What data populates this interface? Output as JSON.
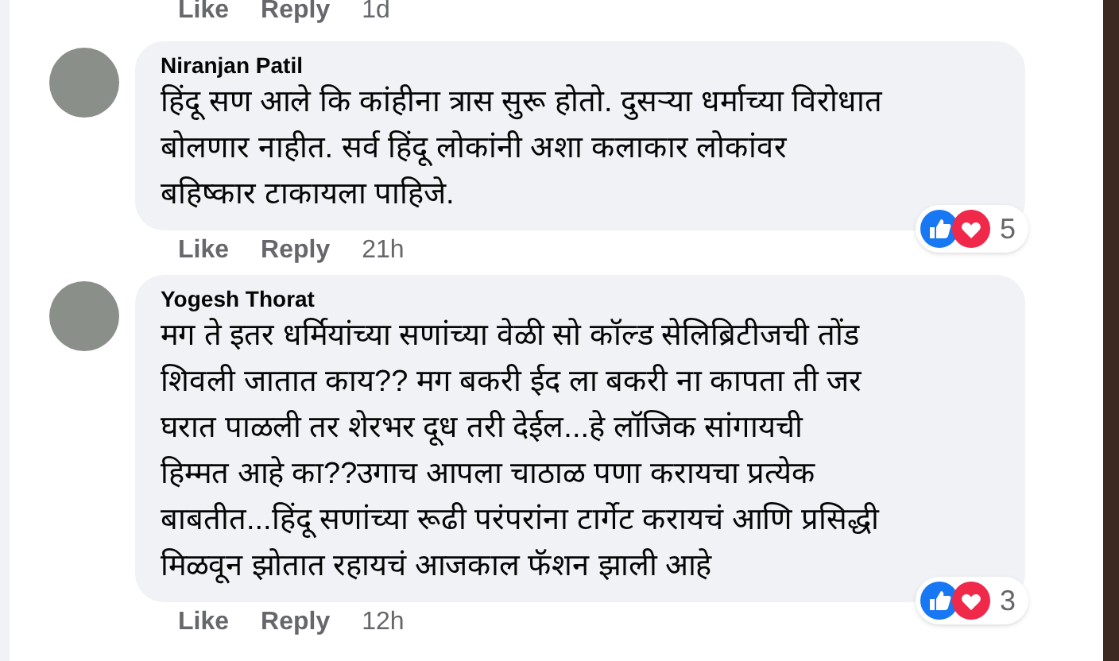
{
  "top_actions": {
    "like": "Like",
    "reply": "Reply",
    "time": "1d"
  },
  "comments": [
    {
      "author": "Niranjan Patil",
      "text": "हिंदू सण आले कि कांहीना त्रास सुरू होतो. दुसऱ्या धर्माच्या विरोधात\nबोलणार नाहीत. सर्व हिंदू लोकांनी अशा कलाकार लोकांवर\nबहिष्कार टाकायला पाहिजे.",
      "reaction_count": "5",
      "like": "Like",
      "reply": "Reply",
      "time": "21h"
    },
    {
      "author": "Yogesh Thorat",
      "text": "मग ते इतर धर्मियांच्या सणांच्या वेळी सो कॉल्ड सेलिब्रिटीजची तोंड\nशिवली जातात काय?? मग बकरी ईद ला बकरी ना कापता ती जर\nघरात पाळली तर शेरभर दूध तरी देईल...हे लॉजिक सांगायची\nहिम्मत आहे का??उगाच आपला चाठाळ पणा करायचा प्रत्येक\nबाबतीत...हिंदू सणांच्या रूढी परंपरांना टार्गेट करायचं आणि प्रसिद्धी\nमिळवून झोतात रहायचं आजकाल फॅशन झाली आहे",
      "reaction_count": "3",
      "like": "Like",
      "reply": "Reply",
      "time": "12h"
    }
  ]
}
